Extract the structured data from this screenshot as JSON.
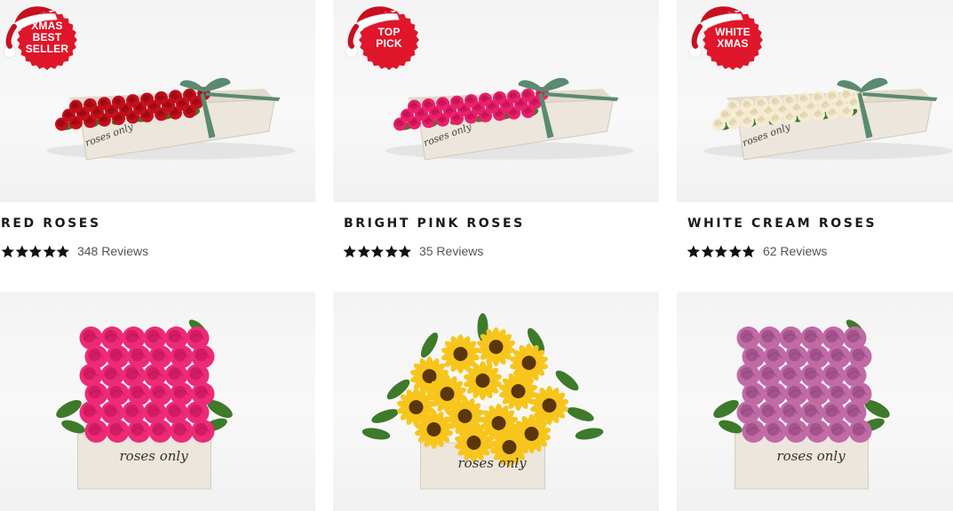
{
  "products": [
    {
      "title": "RED ROSES",
      "badge": [
        "XMAS",
        "BEST",
        "SELLER"
      ],
      "rating": 5,
      "reviews": "348 Reviews",
      "flower_color": "#c4101c",
      "flower_dark": "#8a0610"
    },
    {
      "title": "BRIGHT PINK ROSES",
      "badge": [
        "TOP",
        "PICK"
      ],
      "rating": 5,
      "reviews": "35 Reviews",
      "flower_color": "#ec1f6c",
      "flower_dark": "#b0104a"
    },
    {
      "title": "WHITE CREAM ROSES",
      "badge": [
        "WHITE",
        "XMAS"
      ],
      "rating": 5,
      "reviews": "62 Reviews",
      "flower_color": "#f5ecd2",
      "flower_dark": "#d8caa4"
    },
    {
      "title": "",
      "badge": [],
      "flower_color": "#ee2a78",
      "flower_dark": "#b8124f"
    },
    {
      "title": "",
      "badge": [],
      "flower_color": "#f7c51c",
      "flower_dark": "#5a3608"
    },
    {
      "title": "",
      "badge": [],
      "flower_color": "#c06aa6",
      "flower_dark": "#8a3f77"
    }
  ],
  "box_logo": "roses only",
  "colors": {
    "badge_red": "#e0162b",
    "ribbon": "#5a8a72",
    "leaf": "#3d7a2a",
    "box": "#ece6dc"
  },
  "icons": {
    "star": "star-icon",
    "badge": "santa-hat-badge-icon"
  }
}
